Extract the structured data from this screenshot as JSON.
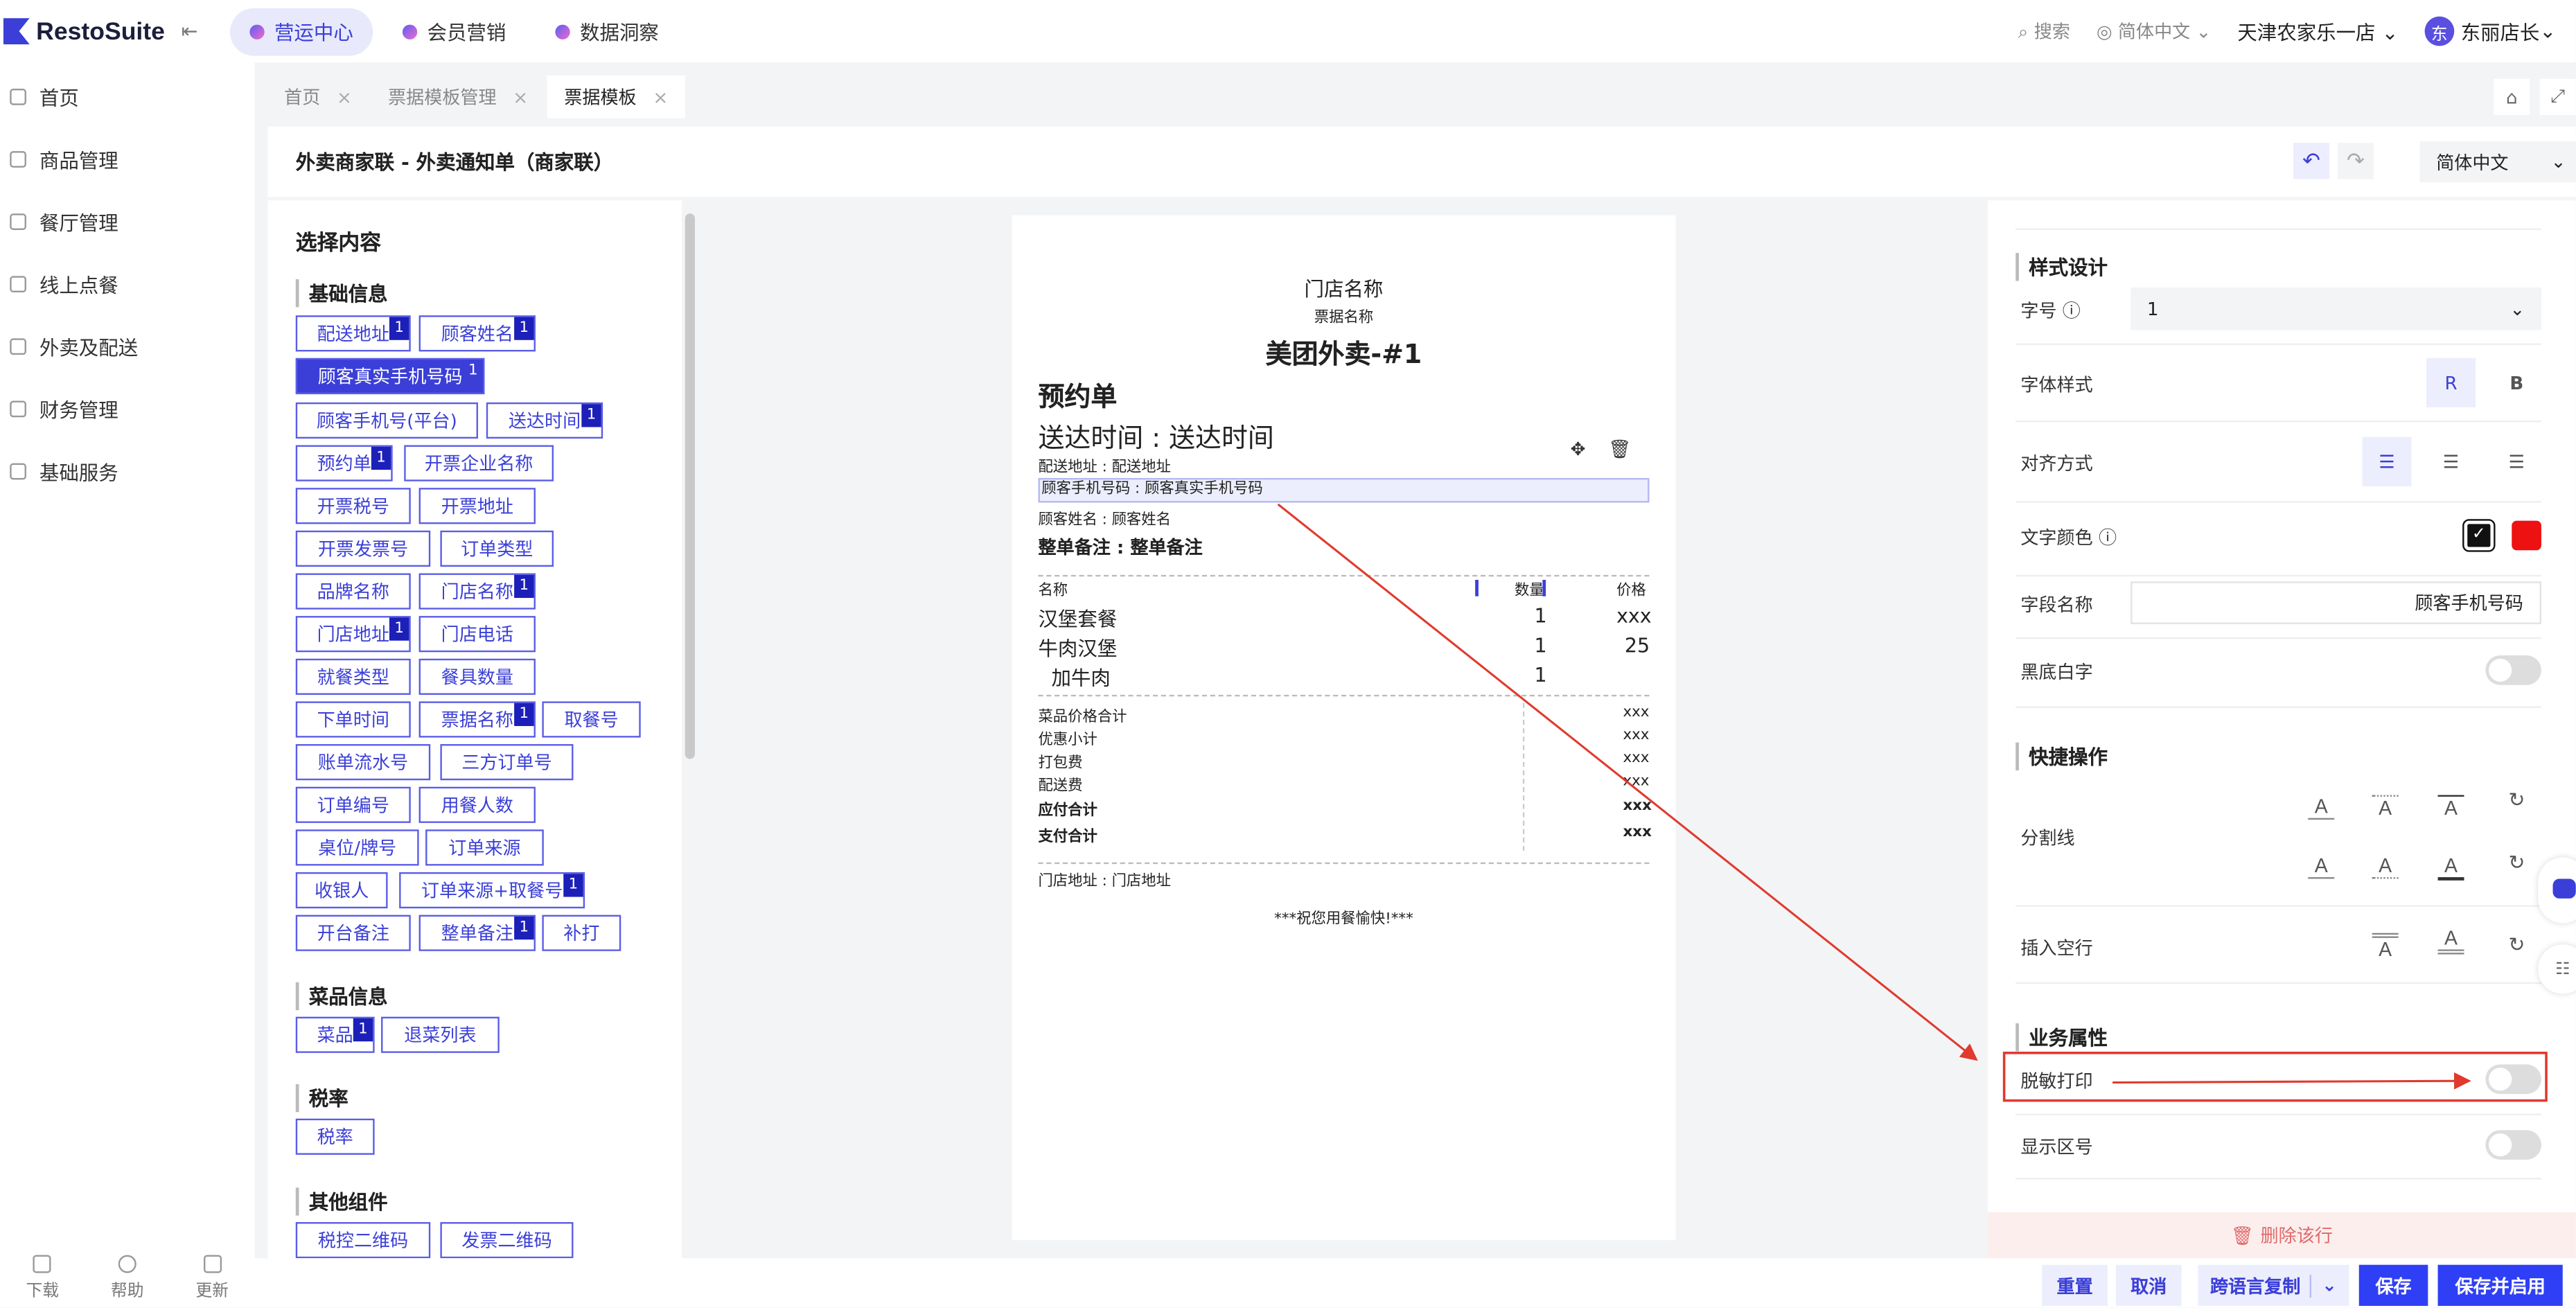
{
  "app": {
    "logo_text": "RestoSuite"
  },
  "topnav": [
    {
      "label": "营运中心",
      "active": true
    },
    {
      "label": "会员营销",
      "active": false
    },
    {
      "label": "数据洞察",
      "active": false
    }
  ],
  "topright": {
    "search": "搜索",
    "language": "简体中文",
    "store": "天津农家乐一店",
    "avatar": "东",
    "user": "东丽店长"
  },
  "sidebar": {
    "items": [
      "首页",
      "商品管理",
      "餐厅管理",
      "线上点餐",
      "外卖及配送",
      "财务管理",
      "基础服务"
    ],
    "bottom": [
      "下载",
      "帮助",
      "更新"
    ]
  },
  "tabs": [
    {
      "label": "首页",
      "active": false
    },
    {
      "label": "票据模板管理",
      "active": false
    },
    {
      "label": "票据模板",
      "active": true
    }
  ],
  "header": {
    "title": "外卖商家联 - 外卖通知单（商家联）",
    "language": "简体中文"
  },
  "left_panel": {
    "title": "选择内容",
    "groups": [
      "基础信息",
      "菜品信息",
      "税率",
      "其他组件"
    ],
    "chips": [
      {
        "label": "配送地址",
        "badge": "1"
      },
      {
        "label": "顾客姓名",
        "badge": "1"
      },
      {
        "label": "顾客真实手机号码",
        "badge": "1",
        "selected": true
      },
      {
        "label": "顾客手机号(平台)",
        "badge": ""
      },
      {
        "label": "送达时间",
        "badge": "1"
      },
      {
        "label": "预约单",
        "badge": "1"
      },
      {
        "label": "开票企业名称",
        "badge": ""
      },
      {
        "label": "开票税号",
        "badge": ""
      },
      {
        "label": "开票地址",
        "badge": ""
      },
      {
        "label": "开票发票号",
        "badge": ""
      },
      {
        "label": "订单类型",
        "badge": ""
      },
      {
        "label": "品牌名称",
        "badge": ""
      },
      {
        "label": "门店名称",
        "badge": "1"
      },
      {
        "label": "门店地址",
        "badge": "1"
      },
      {
        "label": "门店电话",
        "badge": ""
      },
      {
        "label": "就餐类型",
        "badge": ""
      },
      {
        "label": "餐具数量",
        "badge": ""
      },
      {
        "label": "下单时间",
        "badge": ""
      },
      {
        "label": "票据名称",
        "badge": "1"
      },
      {
        "label": "取餐号",
        "badge": ""
      },
      {
        "label": "账单流水号",
        "badge": ""
      },
      {
        "label": "三方订单号",
        "badge": ""
      },
      {
        "label": "订单编号",
        "badge": ""
      },
      {
        "label": "用餐人数",
        "badge": ""
      },
      {
        "label": "桌位/牌号",
        "badge": ""
      },
      {
        "label": "订单来源",
        "badge": ""
      },
      {
        "label": "收银人",
        "badge": ""
      },
      {
        "label": "订单来源+取餐号",
        "badge": "1"
      },
      {
        "label": "开台备注",
        "badge": ""
      },
      {
        "label": "整单备注",
        "badge": "1"
      },
      {
        "label": "补打",
        "badge": ""
      },
      {
        "label": "菜品",
        "badge": "1"
      },
      {
        "label": "退菜列表",
        "badge": ""
      },
      {
        "label": "税率",
        "badge": ""
      },
      {
        "label": "税控二维码",
        "badge": ""
      },
      {
        "label": "发票二维码",
        "badge": ""
      }
    ]
  },
  "receipt": {
    "store_name": "门店名称",
    "doc_name": "票据名称",
    "platform": "美团外卖-#1",
    "reserve": "预约单",
    "delivery_time": "送达时间 : 送达时间",
    "address": "配送地址 : 配送地址",
    "phone": "顾客手机号码 : 顾客真实手机号码",
    "customer": "顾客姓名 : 顾客姓名",
    "remark": "整单备注 : 整单备注",
    "col_name": "名称",
    "col_qty": "数量",
    "col_price": "价格",
    "items": [
      {
        "name": "汉堡套餐",
        "qty": "1",
        "price": "xxx"
      },
      {
        "name": "牛肉汉堡",
        "qty": "1",
        "price": "25"
      },
      {
        "name": "  加牛肉",
        "qty": "1",
        "price": ""
      }
    ],
    "totals": [
      {
        "label": "菜品价格合计",
        "value": "xxx"
      },
      {
        "label": "优惠小计",
        "value": "xxx"
      },
      {
        "label": "打包费",
        "value": "xxx"
      },
      {
        "label": "配送费",
        "value": "xxx"
      },
      {
        "label": "应付合计",
        "value": "xxx"
      },
      {
        "label": "支付合计",
        "value": "xxx"
      }
    ],
    "store_address": "门店地址 : 门店地址",
    "footer": "***祝您用餐愉快!***"
  },
  "right_panel": {
    "style_section": "样式设计",
    "font_size_label": "字号",
    "font_size_value": "1",
    "font_style_label": "字体样式",
    "font_style_r": "R",
    "font_style_b": "B",
    "align_label": "对齐方式",
    "color_label": "文字颜色",
    "field_name_label": "字段名称",
    "field_name_value": "顾客手机号码",
    "invert_label": "黑底白字",
    "quick_section": "快捷操作",
    "divider_label": "分割线",
    "blank_label": "插入空行",
    "biz_section": "业务属性",
    "mask_label": "脱敏打印",
    "area_label": "显示区号",
    "delete_label": "删除该行",
    "colors": [
      "#111111",
      "#ee1111"
    ]
  },
  "footer_buttons": {
    "reset": "重置",
    "cancel": "取消",
    "copy": "跨语言复制",
    "save": "保存",
    "save_enable": "保存并启用"
  }
}
